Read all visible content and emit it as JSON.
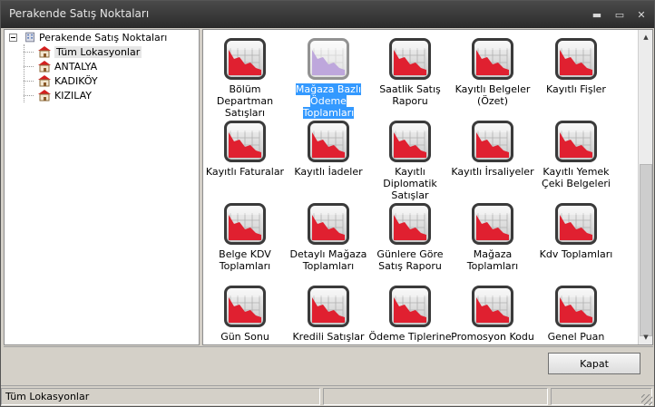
{
  "window": {
    "title": "Perakende Satış Noktaları"
  },
  "titlebar_buttons": {
    "minimize": "▬",
    "maximize": "▭",
    "close": "✕"
  },
  "tree": {
    "root": "Perakende Satış Noktaları",
    "items": [
      {
        "label": "Tüm Lokasyonlar",
        "selected": true
      },
      {
        "label": "ANTALYA"
      },
      {
        "label": "KADIKÖY"
      },
      {
        "label": "KIZILAY"
      }
    ]
  },
  "reports": [
    {
      "label": "Bölüm Departman Satışları"
    },
    {
      "label": "Mağaza Bazlı Ödeme Toplamları",
      "selected": true
    },
    {
      "label": "Saatlik Satış Raporu"
    },
    {
      "label": "Kayıtlı Belgeler (Özet)"
    },
    {
      "label": "Kayıtlı Fişler"
    },
    {
      "label": "Kayıtlı Faturalar"
    },
    {
      "label": "Kayıtlı İadeler"
    },
    {
      "label": "Kayıtlı Diplomatik Satışlar"
    },
    {
      "label": "Kayıtlı İrsaliyeler"
    },
    {
      "label": "Kayıtlı Yemek Çeki Belgeleri"
    },
    {
      "label": "Belge KDV Toplamları"
    },
    {
      "label": "Detaylı Mağaza Toplamları"
    },
    {
      "label": "Günlere Göre Satış Raporu"
    },
    {
      "label": "Mağaza Toplamları"
    },
    {
      "label": "Kdv Toplamları"
    },
    {
      "label": "Gün Sonu Raporu"
    },
    {
      "label": "Kredili Satışlar"
    },
    {
      "label": "Ödeme Tiplerine Göre Satışlar"
    },
    {
      "label": "Promosyon Kodu"
    },
    {
      "label": "Genel Puan"
    }
  ],
  "buttons": {
    "close": "Kapat"
  },
  "status": {
    "location": "Tüm Lokasyonlar",
    "panel2": "",
    "panel3": ""
  },
  "colors": {
    "selection": "#3399ff",
    "chart_red": "#e02030",
    "titlebar": "#2b2b2b"
  }
}
